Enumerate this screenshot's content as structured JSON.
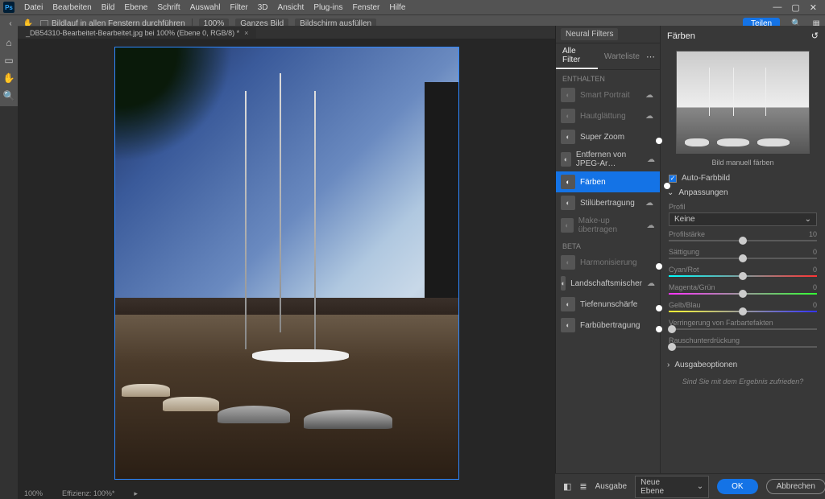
{
  "menubar": {
    "items": [
      "Datei",
      "Bearbeiten",
      "Bild",
      "Ebene",
      "Schrift",
      "Auswahl",
      "Filter",
      "3D",
      "Ansicht",
      "Plug-ins",
      "Fenster",
      "Hilfe"
    ]
  },
  "optionsbar": {
    "scroll_all": "Bildlauf in allen Fenstern durchführen",
    "zoom": "100%",
    "fit": "Ganzes Bild",
    "fillscreen": "Bildschirm ausfüllen",
    "share": "Teilen"
  },
  "document": {
    "tab": "_DB54310-Bearbeitet-Bearbeitet.jpg bei 100% (Ebene 0, RGB/8) *",
    "status_zoom": "100%",
    "status_eff": "Effizienz: 100%*"
  },
  "neural": {
    "title": "Neural Filters",
    "tabs": {
      "all": "Alle Filter",
      "wait": "Warteliste"
    },
    "groups": {
      "enthalten": "ENTHALTEN",
      "beta": "BETA"
    },
    "filters": {
      "smart_portrait": "Smart Portrait",
      "hautglaettung": "Hautglättung",
      "super_zoom": "Super Zoom",
      "jpeg": "Entfernen von JPEG-Ar…",
      "faerben": "Färben",
      "stiluebertragung": "Stilübertragung",
      "makeup": "Make-up übertragen",
      "harmonisierung": "Harmonisierung",
      "landschaft": "Landschaftsmischer",
      "tiefe": "Tiefenunschärfe",
      "farbtransfer": "Farbübertragung"
    }
  },
  "faerben_panel": {
    "title": "Färben",
    "preview_caption": "Bild manuell färben",
    "auto_label": "Auto-Farbbild",
    "anpassungen": "Anpassungen",
    "profil": "Profil",
    "profil_value": "Keine",
    "profilstaerke": "Profilstärke",
    "profilstaerke_val": "10",
    "saettigung": "Sättigung",
    "saettigung_val": "0",
    "cyanrot": "Cyan/Rot",
    "cyanrot_val": "0",
    "magentagruen": "Magenta/Grün",
    "magentagruen_val": "0",
    "gelbblau": "Gelb/Blau",
    "gelbblau_val": "0",
    "farbartefakte": "Verringerung von Farbartefakten",
    "rauschen": "Rauschunterdrückung",
    "ausgabeoptionen": "Ausgabeoptionen",
    "feedback": "Sind Sie mit dem Ergebnis zufrieden?"
  },
  "bottom": {
    "ausgabe": "Ausgabe",
    "ausgabe_value": "Neue Ebene",
    "ok": "OK",
    "cancel": "Abbrechen"
  }
}
